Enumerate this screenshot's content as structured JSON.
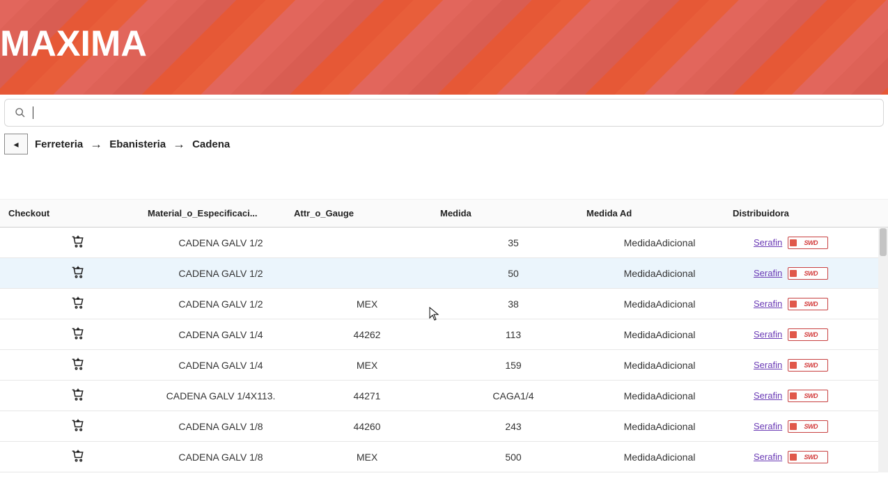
{
  "hero": {
    "title": "MAXIMA"
  },
  "search": {
    "placeholder": ""
  },
  "breadcrumb": [
    "Ferreteria",
    "Ebanisteria",
    "Cadena"
  ],
  "table": {
    "headers": [
      "Checkout",
      "Material_o_Especificaci...",
      "Attr_o_Gauge",
      "Medida",
      "Medida Ad",
      "Distribuidora"
    ],
    "rows": [
      {
        "mat": "CADENA GALV 1/2",
        "gauge": "",
        "medida": "35",
        "medidaad": "MedidaAdicional",
        "dist": "Serafin",
        "hl": false
      },
      {
        "mat": "CADENA GALV 1/2",
        "gauge": "",
        "medida": "50",
        "medidaad": "MedidaAdicional",
        "dist": "Serafin",
        "hl": true
      },
      {
        "mat": "CADENA GALV 1/2",
        "gauge": "MEX",
        "medida": "38",
        "medidaad": "MedidaAdicional",
        "dist": "Serafin",
        "hl": false
      },
      {
        "mat": "CADENA GALV 1/4",
        "gauge": "44262",
        "medida": "113",
        "medidaad": "MedidaAdicional",
        "dist": "Serafin",
        "hl": false
      },
      {
        "mat": "CADENA GALV 1/4",
        "gauge": "MEX",
        "medida": "159",
        "medidaad": "MedidaAdicional",
        "dist": "Serafin",
        "hl": false
      },
      {
        "mat": "CADENA GALV 1/4X113.",
        "gauge": "44271",
        "medida": "CAGA1/4",
        "medidaad": "MedidaAdicional",
        "dist": "Serafin",
        "hl": false
      },
      {
        "mat": "CADENA GALV 1/8",
        "gauge": "44260",
        "medida": "243",
        "medidaad": "MedidaAdicional",
        "dist": "Serafin",
        "hl": false
      },
      {
        "mat": "CADENA GALV 1/8",
        "gauge": "MEX",
        "medida": "500",
        "medidaad": "MedidaAdicional",
        "dist": "Serafin",
        "hl": false
      }
    ]
  },
  "distributor_logo_text": "SWD"
}
